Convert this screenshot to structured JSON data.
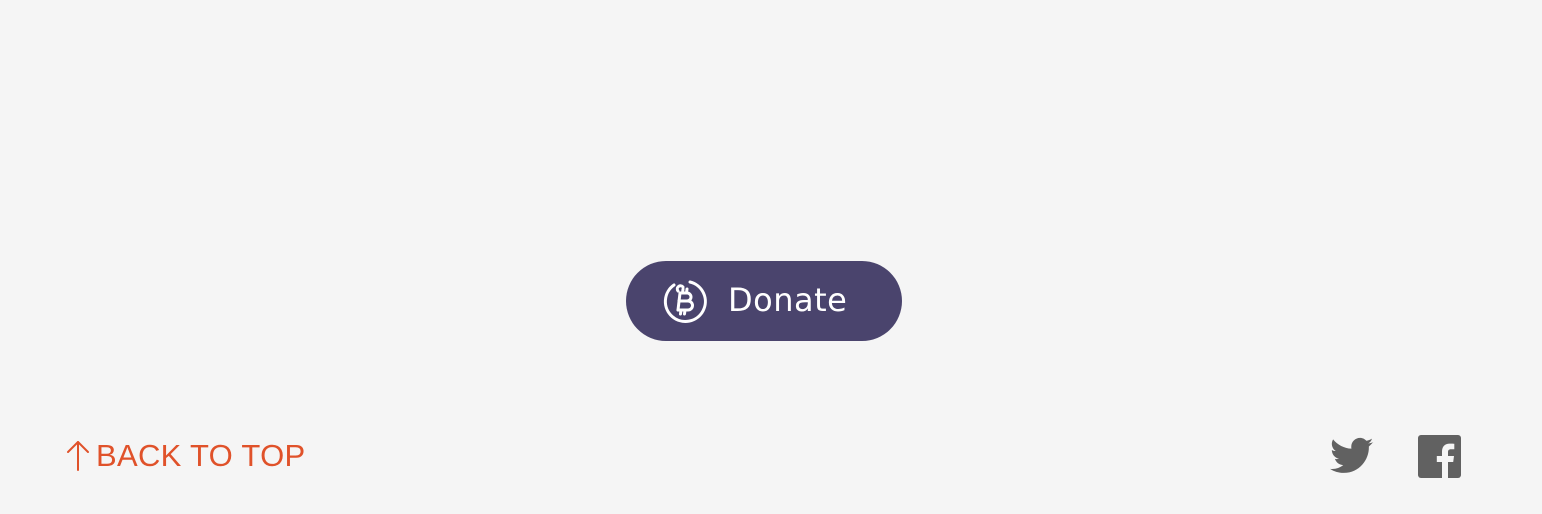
{
  "donate": {
    "label": "Donate",
    "icon": "bitcoin-coin-icon",
    "background": "#4a446d",
    "text_color": "#ffffff"
  },
  "footer": {
    "back_to_top_arrow": "arrow-up-icon",
    "back_to_top_label": "BACK TO TOP",
    "accent_color": "#e0522a",
    "social": [
      {
        "icon": "twitter-icon"
      },
      {
        "icon": "facebook-icon"
      }
    ],
    "social_color": "#616161"
  },
  "page_background": "#f5f5f5"
}
